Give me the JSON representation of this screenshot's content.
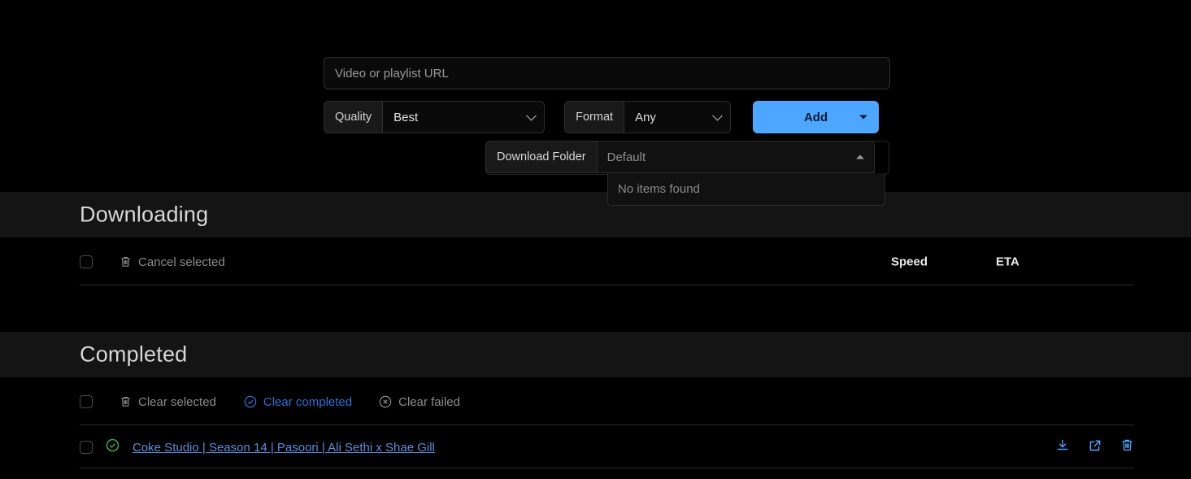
{
  "colors": {
    "background": "#000000",
    "band": "#141414",
    "accent_blue": "#4da6ff",
    "link_blue": "#5b8ede",
    "action_blue": "#2f6fd6",
    "success_green": "#3ea84a",
    "muted_text": "#8c8c8c",
    "divider": "#2a2a2a"
  },
  "form": {
    "url": {
      "value": "",
      "placeholder": "Video or playlist URL"
    },
    "quality": {
      "label": "Quality",
      "value": "Best",
      "chevron_icon": "chevron-down-icon"
    },
    "format": {
      "label": "Format",
      "value": "Any",
      "chevron_icon": "chevron-down-icon"
    },
    "add_button": {
      "label": "Add",
      "caret_icon": "caret-down-icon"
    },
    "download_folder": {
      "label": "Download Folder",
      "value": "Default",
      "chevron_icon": "chevron-up-icon",
      "menu": {
        "open": true,
        "items": [
          "No items found"
        ]
      }
    }
  },
  "downloading": {
    "title": "Downloading",
    "toolbar": {
      "select_all_checkbox": "",
      "cancel_selected": {
        "label": "Cancel selected",
        "icon": "trash-icon"
      }
    },
    "columns": {
      "speed": "Speed",
      "eta": "ETA"
    },
    "rows": []
  },
  "completed": {
    "title": "Completed",
    "toolbar": {
      "select_all_checkbox": "",
      "clear_selected": {
        "label": "Clear selected",
        "icon": "trash-icon"
      },
      "clear_completed": {
        "label": "Clear completed",
        "icon": "check-circle-icon"
      },
      "clear_failed": {
        "label": "Clear failed",
        "icon": "x-circle-icon"
      }
    },
    "rows": [
      {
        "status_icon": "check-circle-icon",
        "title": "Coke Studio | Season 14 | Pasoori | Ali Sethi x Shae Gill",
        "actions": {
          "download": "download-icon",
          "open_external": "external-link-icon",
          "delete": "trash-icon"
        }
      }
    ]
  }
}
